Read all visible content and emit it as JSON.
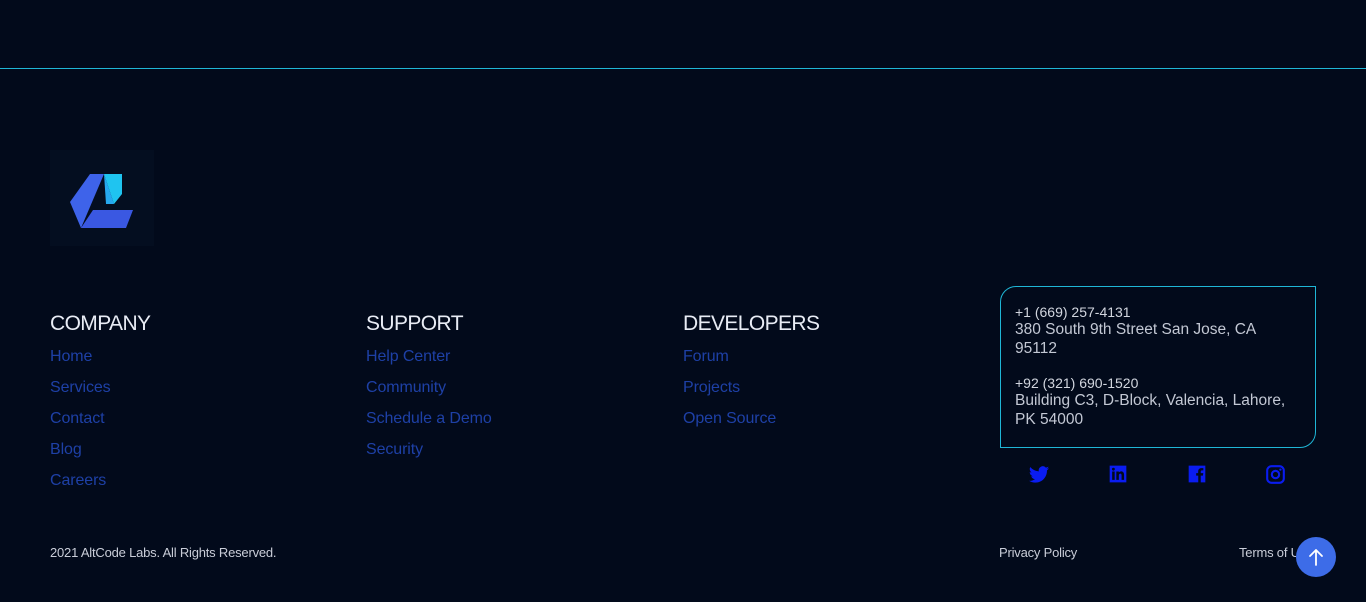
{
  "brand": {
    "logo_icon": "altcode-logo-icon"
  },
  "columns": {
    "company": {
      "title": "COMPANY",
      "links": [
        "Home",
        "Services",
        "Contact",
        "Blog",
        "Careers"
      ]
    },
    "support": {
      "title": "SUPPORT",
      "links": [
        "Help Center",
        "Community",
        "Schedule a Demo",
        "Security"
      ]
    },
    "developers": {
      "title": "DEVELOPERS",
      "links": [
        "Forum",
        "Projects",
        "Open Source"
      ]
    }
  },
  "contact": {
    "us_phone": "+1 (669) 257-4131",
    "us_address": "380 South 9th Street San Jose, CA 95112",
    "pk_phone": "+92 (321) 690-1520",
    "pk_address": "Building C3, D-Block, Valencia, Lahore, PK 54000"
  },
  "social": [
    "twitter-icon",
    "linkedin-icon",
    "facebook-icon",
    "instagram-icon"
  ],
  "footer": {
    "copyright": "2021 AltCode Labs. All Rights Reserved.",
    "privacy": "Privacy Policy",
    "terms": "Terms of Use"
  },
  "colors": {
    "background": "#020a1b",
    "accent_line": "#1fb6d6",
    "link": "#1e40a6",
    "social_icon": "#0a1cf0",
    "scroll_top_button": "#3d6ce8"
  }
}
